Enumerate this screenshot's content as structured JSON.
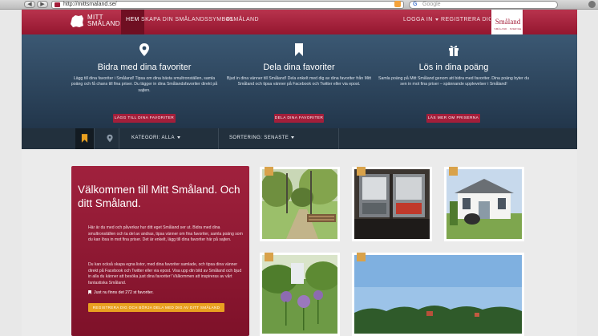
{
  "browser": {
    "url": "http://mittsmaland.se/",
    "search_placeholder": "Google"
  },
  "nav": {
    "logo_line1": "MITT",
    "logo_line2": "SMÅLAND",
    "items": [
      {
        "label": "HEM",
        "active": true
      },
      {
        "label": "SKAPA DIN SMÅLANDSSYMBOL",
        "active": false
      },
      {
        "label": "#SMÅLAND",
        "active": false
      }
    ],
    "login": "LOGGA IN",
    "register": "REGISTRERA DIG",
    "brand": "Småland",
    "brand_sub": "SMÅLAND · SVERIGE"
  },
  "info": [
    {
      "icon": "map-pin-icon",
      "title": "Bidra med dina favoriter",
      "text": "Lägg till dina favoriter i Småland! Tipsa om dina bästa smultronställen, samla poäng och få chans till fina priser. Du lägger in dina Smålandsfavoriter direkt på sajten.",
      "button": "LÄGG TILL DINA FAVORITER"
    },
    {
      "icon": "bookmark-icon",
      "title": "Dela dina favoriter",
      "text": "Bjud in dina vänner till Småland! Dela enkelt med dig av dina favoriter från Mitt Småland och tipsa vänner på Facebook och Twitter eller via epost.",
      "button": "DELA DINA FAVORITER"
    },
    {
      "icon": "gift-icon",
      "title": "Lös in dina poäng",
      "text": "Samla poäng på Mitt Småland genom att bidra med favoriter. Dina poäng byter du sen in mot fina priser – spännande upplevelser i Småland!",
      "button": "LÄS MER OM PRISERNA"
    }
  ],
  "filter": {
    "category": "KATEGORI: ALLA",
    "sort": "SORTERING: SENASTE"
  },
  "welcome": {
    "title": "Välkommen till Mitt Småland. Och ditt Småland.",
    "p1": "Här är du med och påverkar hur ditt eget Småland ser ut. Bidra med dina smultronställen och ta del av andras, tipsa vänner om fina favoriter, samla poäng som du kan lösa in mot fina priser. Det är enkelt, lägg till dina favoriter här på sajten.",
    "p2": "Du kan också skapa egna listor, med dina favoriter samlade, och tipsa dina vänner direkt på Facebook och Twitter eller via epost. Visa upp din bild av Småland och bjud in alla du känner att besöka just dina favoriter! Välkommen att inspireras av vårt fantastiska Småland.",
    "count": "Just nu finns det 272 st favoriter.",
    "cta": "REGISTRERA DIG OCH BÖRJA DELA MED DIG AV DITT SMÅLAND"
  },
  "cards": [
    {
      "tag": "leaf-icon",
      "alt": "Skogsstig med stängsel"
    },
    {
      "tag": "leaf-icon",
      "alt": "Skylt i fönster"
    },
    {
      "tag": "fork-knife-icon",
      "alt": "Vit villa med skylt"
    },
    {
      "tag": "leaf-icon",
      "alt": "Trädgård med alliumblommor"
    },
    {
      "tag": "camera-icon",
      "alt": "Landskap med sjö och himmel"
    }
  ],
  "colors": {
    "brand_red": "#a31e3a",
    "band_blue": "#2c4660",
    "filter_dark": "#22303d",
    "cta_orange": "#e9a020"
  }
}
